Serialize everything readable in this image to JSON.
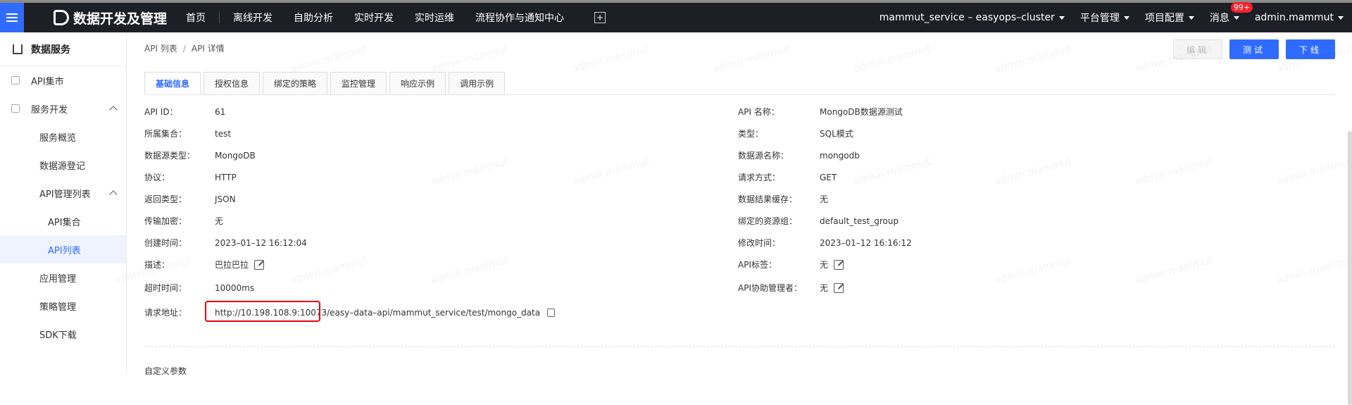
{
  "topbar": {
    "brand": "数据开发及管理",
    "nav": [
      "首页",
      "离线开发",
      "自助分析",
      "实时开发",
      "实时运维",
      "流程协作与通知中心"
    ],
    "cluster": "mammut_service – easyops–cluster",
    "platform": "平台管理",
    "project": "项目配置",
    "messages": "消息",
    "badge": "99+",
    "user": "admin.mammut"
  },
  "sidebar": {
    "title": "数据服务",
    "items": [
      {
        "label": "API集市"
      },
      {
        "label": "服务开发"
      },
      {
        "label": "服务概览"
      },
      {
        "label": "数据源登记"
      },
      {
        "label": "API管理列表"
      },
      {
        "label": "API集合"
      },
      {
        "label": "API列表"
      },
      {
        "label": "应用管理"
      },
      {
        "label": "策略管理"
      },
      {
        "label": "SDK下载"
      }
    ]
  },
  "breadcrumb": {
    "root": "API 列表",
    "sep": "/",
    "current": "API 详情"
  },
  "actions": {
    "edit": "编辑",
    "test": "测试",
    "offline": "下线"
  },
  "tabs": [
    "基础信息",
    "授权信息",
    "绑定的策略",
    "监控管理",
    "响应示例",
    "调用示例"
  ],
  "left_fields": [
    {
      "label": "API ID：",
      "value": "61"
    },
    {
      "label": "所属集合：",
      "value": "test"
    },
    {
      "label": "数据源类型：",
      "value": "MongoDB"
    },
    {
      "label": "协议：",
      "value": "HTTP"
    },
    {
      "label": "返回类型：",
      "value": "JSON"
    },
    {
      "label": "传输加密：",
      "value": "无"
    },
    {
      "label": "创建时间：",
      "value": "2023–01–12 16:12:04"
    },
    {
      "label": "描述：",
      "value": "巴拉巴拉"
    },
    {
      "label": "超时时间：",
      "value": "10000ms"
    },
    {
      "label": "请求地址：",
      "value": "http://10.198.108.9:10073/easy–data–api/mammut_service/test/mongo_data"
    }
  ],
  "right_fields": [
    {
      "label": "API 名称：",
      "value": "MongoDB数据源测试"
    },
    {
      "label": "类型：",
      "value": "SQL模式"
    },
    {
      "label": "数据源名称：",
      "value": "mongodb"
    },
    {
      "label": "请求方式：",
      "value": "GET"
    },
    {
      "label": "数据结果缓存：",
      "value": "无"
    },
    {
      "label": "绑定的资源组：",
      "value": "default_test_group"
    },
    {
      "label": "修改时间：",
      "value": "2023–01–12 16:16:12"
    },
    {
      "label": "API标签：",
      "value": "无"
    },
    {
      "label": "API协助管理者：",
      "value": "无"
    }
  ],
  "section_title": "自定义参数",
  "watermark": "admin.mammut"
}
